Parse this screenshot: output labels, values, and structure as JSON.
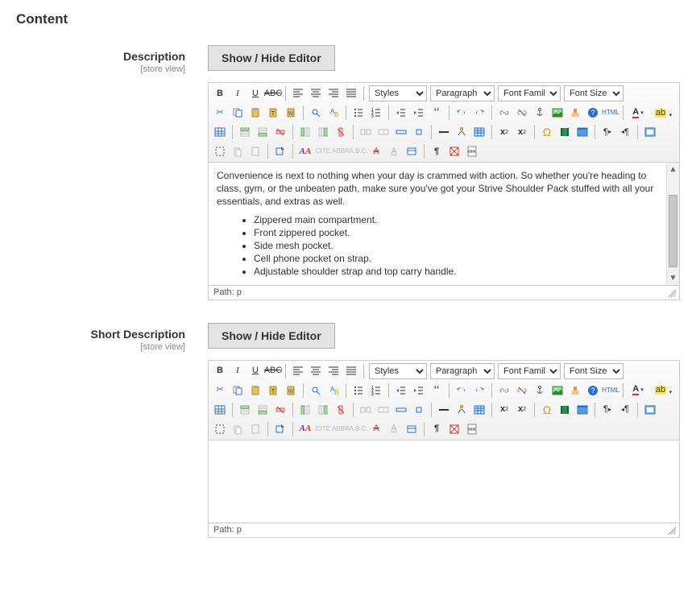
{
  "section_title": "Content",
  "fields": {
    "description": {
      "label": "Description",
      "scope": "[store view]",
      "toggle_label": "Show / Hide Editor",
      "path": "Path: p",
      "content_paragraph": "Convenience is next to nothing when your day is crammed with action. So whether you're heading to class, gym, or the unbeaten path, make sure you've got your Strive Shoulder Pack stuffed with all your essentials, and extras as well.",
      "content_bullets": [
        "Zippered main compartment.",
        "Front zippered pocket.",
        "Side mesh pocket.",
        "Cell phone pocket on strap.",
        "Adjustable shoulder strap and top carry handle."
      ]
    },
    "short_description": {
      "label": "Short Description",
      "scope": "[store view]",
      "toggle_label": "Show / Hide Editor",
      "path": "Path: p",
      "content": ""
    }
  },
  "toolbar": {
    "selects": {
      "styles": "Styles",
      "paragraph": "Paragraph",
      "font_family": "Font Family",
      "font_size": "Font Size"
    },
    "row1": [
      "bold",
      "italic",
      "underline",
      "strike",
      "sep",
      "align-left",
      "align-center",
      "align-right",
      "align-justify",
      "sep"
    ],
    "row2": [
      "cut",
      "copy",
      "paste",
      "paste-text",
      "paste-word",
      "sep",
      "find",
      "replace",
      "sep",
      "ul",
      "ol",
      "sep",
      "outdent",
      "indent",
      "blockquote",
      "sep",
      "undo",
      "redo",
      "sep",
      "link",
      "unlink",
      "anchor",
      "image",
      "cleanup",
      "help",
      "html",
      "sep",
      "fontcolor",
      "hilite"
    ],
    "row3": [
      "table",
      "sep",
      "row-before",
      "row-after",
      "row-del",
      "sep",
      "col-before",
      "col-after",
      "col-del",
      "sep",
      "split",
      "merge",
      "row-props",
      "cell-props",
      "sep",
      "hr",
      "remove-fmt",
      "show-blocks",
      "sep",
      "sub",
      "sup",
      "sep",
      "omega",
      "media",
      "fullscreen",
      "sep",
      "ltr",
      "rtl",
      "sep",
      "layer"
    ],
    "row4": [
      "crop",
      "copy2",
      "paste2",
      "sep",
      "indent2",
      "sep",
      "style-aa",
      "cite",
      "abbr",
      "acr",
      "del-txt",
      "attr-a",
      "attr-a2",
      "insert-file",
      "sep",
      "pilcrow",
      "no-img",
      "page-break"
    ]
  }
}
